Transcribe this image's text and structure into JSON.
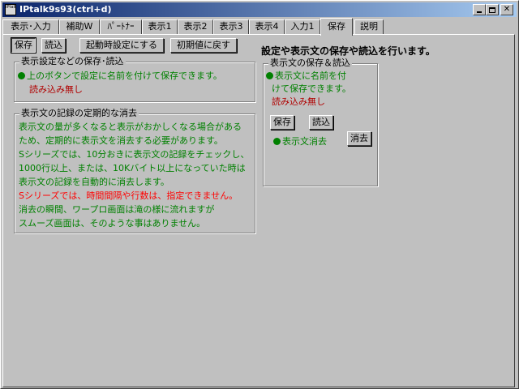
{
  "window": {
    "title": "IPtalk9s93(ctrl+d)",
    "app_icon_text": "IPtalk"
  },
  "tabs": [
    {
      "label": "表示･入力"
    },
    {
      "label": "補助W"
    },
    {
      "label": "ﾊﾟｰﾄﾅｰ"
    },
    {
      "label": "表示1"
    },
    {
      "label": "表示2"
    },
    {
      "label": "表示3"
    },
    {
      "label": "表示4"
    },
    {
      "label": "入力1"
    },
    {
      "label": "保存"
    },
    {
      "label": "説明"
    }
  ],
  "toolbar": {
    "save_label": "保存",
    "load_label": "読込",
    "startup_label": "起動時設定にする",
    "reset_label": "初期値に戻す"
  },
  "heading": "設定や表示文の保存や読込を行います。",
  "settings_group": {
    "title": "表示設定などの保存･読込",
    "info": "上のボタンで設定に名前を付けて保存できます。",
    "status": "読み込み無し"
  },
  "delete_group": {
    "title": "表示文の記録の定期的な消去",
    "lines": [
      "表示文の量が多くなると表示がおかしくなる場合がある",
      "ため、定期的に表示文を消去する必要があります。",
      "Sシリーズでは、10分おきに表示文の記録をチェックし、",
      "1000行以上、または、10Kバイト以上になっていた時は",
      "表示文の記録を自動的に消去します。"
    ],
    "warning": "Sシリーズでは、時間間隔や行数は、指定できません。",
    "lines2": [
      "消去の瞬間、ワープロ画面は滝の様に流れますが",
      "スムーズ画面は、そのような事はありません。"
    ]
  },
  "text_group": {
    "title": "表示文の保存＆読込",
    "info_line1": "表示文に名前を付",
    "info_line2": "けて保存できます。",
    "status": "読み込み無し",
    "save_label": "保存",
    "load_label": "読込",
    "delete_info": "表示文消去",
    "delete_label": "消去"
  },
  "colors": {
    "title_start": "#0a246a",
    "title_end": "#a6caf0",
    "face": "#c0c0c0",
    "info_text": "#008000",
    "status_text": "#b00000",
    "warning_text": "#ff0000"
  }
}
